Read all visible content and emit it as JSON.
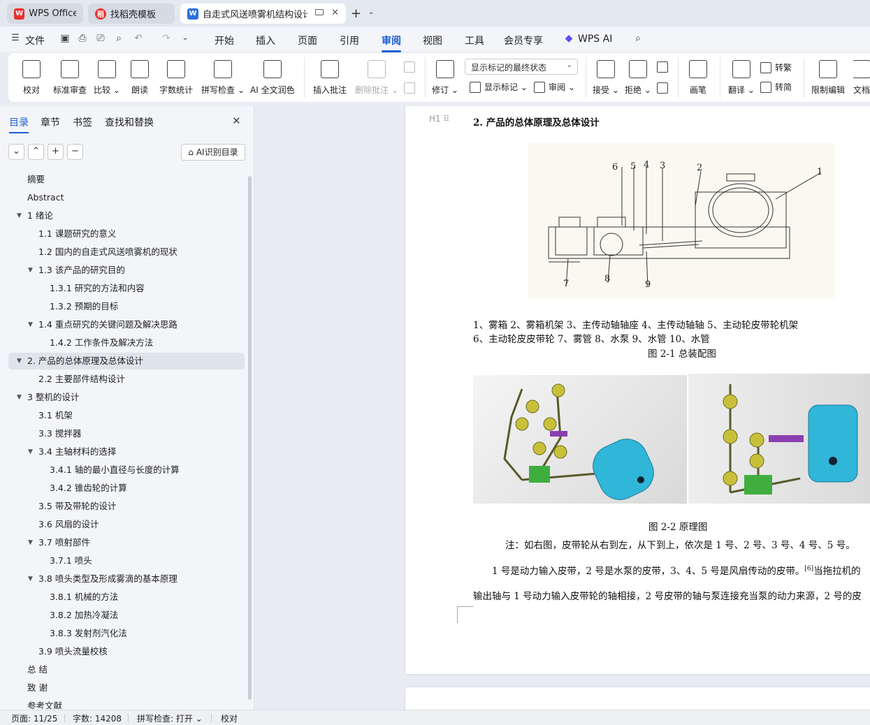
{
  "tabs": [
    {
      "label": "WPS Office",
      "icon": "wps-logo-icon",
      "color": "#e8322e"
    },
    {
      "label": "找稻壳模板",
      "icon": "docer-icon",
      "color": "#e8322e"
    },
    {
      "label": "自走式风送喷雾机结构设计 说",
      "icon": "word-doc-icon",
      "color": "#2b6fe0"
    }
  ],
  "menu": {
    "file": "文件",
    "items": [
      "开始",
      "插入",
      "页面",
      "引用",
      "审阅",
      "视图",
      "工具",
      "会员专享"
    ],
    "active": "审阅",
    "wps_ai": "WPS AI"
  },
  "ribbon": {
    "proofread": "校对",
    "standard_review": "标准审查",
    "compare": "比较",
    "read_aloud": "朗读",
    "word_count": "字数统计",
    "spell_check": "拼写检查",
    "ai_polish": "AI 全文润色",
    "insert_comment": "插入批注",
    "delete_comment": "删除批注",
    "track_changes": "修订",
    "markup_mode": "显示标记的最终状态",
    "show_markup": "显示标记",
    "review": "审阅",
    "accept": "接受",
    "reject": "拒绝",
    "ink": "画笔",
    "translate": "翻译",
    "to_traditional": "转繁",
    "to_simplified": "转简",
    "restrict_edit": "限制编辑",
    "doc_more": "文档"
  },
  "panel": {
    "tabs": [
      "目录",
      "章节",
      "书签",
      "查找和替换"
    ],
    "ai_toc": "AI识别目录"
  },
  "toc": [
    {
      "label": "摘要",
      "level": 1,
      "caret": false
    },
    {
      "label": "Abstract",
      "level": 1,
      "caret": false
    },
    {
      "label": "1  绪论",
      "level": 1,
      "caret": true
    },
    {
      "label": "1.1 课题研究的意义",
      "level": 2,
      "caret": false
    },
    {
      "label": "1.2 国内的自走式风送喷雾机的现状",
      "level": 2,
      "caret": false
    },
    {
      "label": "1.3  该产品的研究目的",
      "level": 2,
      "caret": true
    },
    {
      "label": "1.3.1  研究的方法和内容",
      "level": 3,
      "caret": false
    },
    {
      "label": "1.3.2 预期的目标",
      "level": 3,
      "caret": false
    },
    {
      "label": "1.4 重点研究的关键问题及解决思路",
      "level": 2,
      "caret": true
    },
    {
      "label": "1.4.2 工作条件及解决方法",
      "level": 3,
      "caret": false
    },
    {
      "label": "2.  产品的总体原理及总体设计",
      "level": 1,
      "caret": true,
      "selected": true
    },
    {
      "label": "2.2  主要部件结构设计",
      "level": 2,
      "caret": false
    },
    {
      "label": "3  整机的设计",
      "level": 1,
      "caret": true
    },
    {
      "label": "3.1  机架",
      "level": 2,
      "caret": false
    },
    {
      "label": "3.3  搅拌器",
      "level": 2,
      "caret": false
    },
    {
      "label": "3.4  主轴材料的选择",
      "level": 2,
      "caret": true
    },
    {
      "label": "3.4.1  轴的最小直径与长度的计算",
      "level": 3,
      "caret": false
    },
    {
      "label": "3.4.2  锥齿轮的计算",
      "level": 3,
      "caret": false
    },
    {
      "label": "3.5  带及带轮的设计",
      "level": 2,
      "caret": false
    },
    {
      "label": "3.6  风扇的设计",
      "level": 2,
      "caret": false
    },
    {
      "label": "3.7 喷射部件",
      "level": 2,
      "caret": true
    },
    {
      "label": "3.7.1  喷头",
      "level": 3,
      "caret": false
    },
    {
      "label": "3.8 喷头类型及形成雾滴的基本原理",
      "level": 2,
      "caret": true
    },
    {
      "label": "3.8.1  机械的方法",
      "level": 3,
      "caret": false
    },
    {
      "label": "3.8.2  加热冷凝法",
      "level": 3,
      "caret": false
    },
    {
      "label": "3.8.3  发射剂汽化法",
      "level": 3,
      "caret": false
    },
    {
      "label": "3.9  喷头流量校核",
      "level": 2,
      "caret": false
    },
    {
      "label": "总   结",
      "level": 1,
      "caret": false
    },
    {
      "label": "致   谢",
      "level": 1,
      "caret": false
    },
    {
      "label": "参考文献",
      "level": 1,
      "caret": false
    }
  ],
  "document": {
    "heading": "2.  产品的总体原理及总体设计",
    "fig1_labels": [
      "6",
      "5",
      "4",
      "3",
      "2",
      "1",
      "7",
      "8",
      "9"
    ],
    "legend_line1": "1、雾箱  2、雾箱机架  3、主传动轴轴座  4、主传动轴轴  5、主动轮皮带轮机架",
    "legend_line2": "6、主动轮皮皮带轮     7、雾管   8、水泵   9、水管  10、水管",
    "fig1_caption": "图  2-1 总装配图",
    "fig2_caption": "图  2-2    原理图",
    "note": "注：如右图，皮带轮从右到左，从下到上，依次是 1 号、2 号、3 号、4 号、5 号。",
    "para1": "1 号是动力输入皮带，2 号是水泵的皮带，3、4、5 号是风扇传动的皮带。",
    "para1_ref": "[6]",
    "para1_tail": "当拖拉机的",
    "para2": "输出轴与 1 号动力输入皮带轮的轴相接，2 号皮带的轴与泵连接充当泵的动力来源，2 号的皮"
  },
  "status": {
    "page": "页面: 11/25",
    "words": "字数: 14208",
    "spell": "拼写检查: 打开",
    "proof": "校对"
  }
}
